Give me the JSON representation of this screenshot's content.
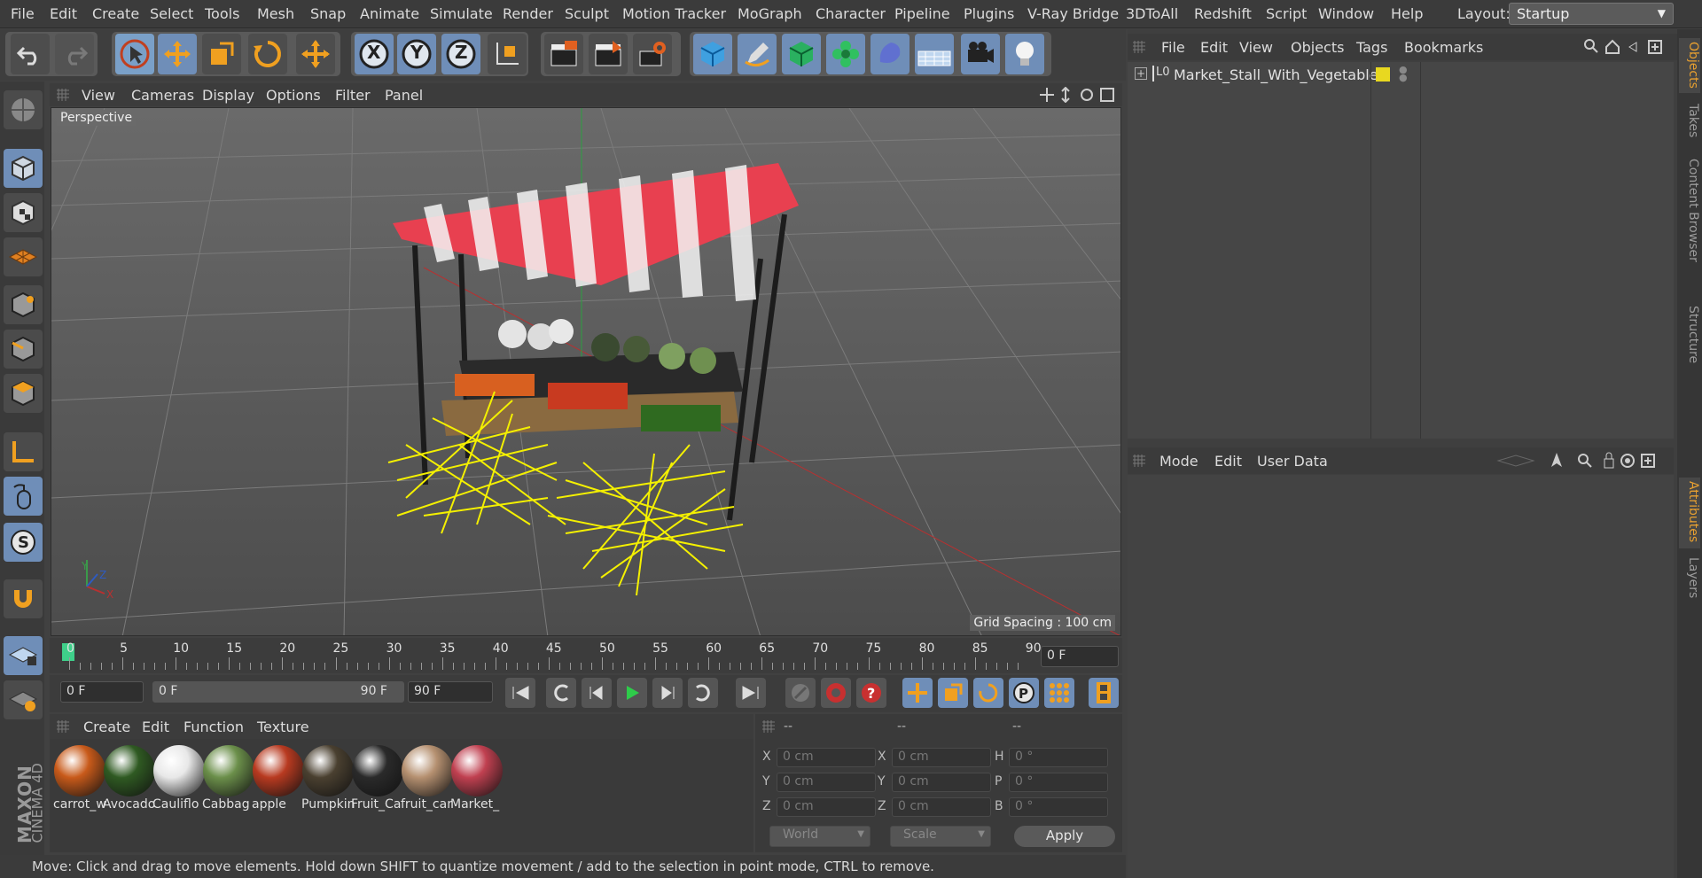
{
  "menu": [
    "File",
    "Edit",
    "Create",
    "Select",
    "Tools",
    "Mesh",
    "Snap",
    "Animate",
    "Simulate",
    "Render",
    "Sculpt",
    "Motion Tracker",
    "MoGraph",
    "Character",
    "Pipeline",
    "Plugins",
    "V-Ray Bridge",
    "3DToAll",
    "Redshift",
    "Script",
    "Window",
    "Help"
  ],
  "layout": {
    "label": "Layout:",
    "value": "Startup"
  },
  "toolbar": {
    "x_label": "X",
    "y_label": "Y",
    "z_label": "Z"
  },
  "viewport": {
    "menu": [
      "View",
      "Cameras",
      "Display",
      "Options",
      "Filter",
      "Panel"
    ],
    "label": "Perspective",
    "grid_spacing": "Grid Spacing : 100 cm",
    "axis": {
      "x": "X",
      "y": "Y",
      "z": "Z"
    }
  },
  "timeline": {
    "ticks": [
      "0",
      "5",
      "10",
      "15",
      "20",
      "25",
      "30",
      "35",
      "40",
      "45",
      "50",
      "55",
      "60",
      "65",
      "70",
      "75",
      "80",
      "85",
      "90"
    ],
    "current_frame": "0 F"
  },
  "playback": {
    "start": "0 F",
    "range_start": "0 F",
    "range_end": "90 F",
    "end": "90 F"
  },
  "materials": {
    "menu": [
      "Create",
      "Edit",
      "Function",
      "Texture"
    ],
    "items": [
      {
        "name": "carrot_w",
        "color": "#c85a1a"
      },
      {
        "name": "Avocado",
        "color": "#2f5a22"
      },
      {
        "name": "Cauliflo",
        "color": "#e8e8e8"
      },
      {
        "name": "Cabbag",
        "color": "#6b8f4a"
      },
      {
        "name": "apple",
        "color": "#b83a20"
      },
      {
        "name": "Pumpkin",
        "color": "#4a4030"
      },
      {
        "name": "Fruit_Ca",
        "color": "#2a2a2a"
      },
      {
        "name": "fruit_car",
        "color": "#b59070"
      },
      {
        "name": "Market_",
        "color": "#c04050"
      }
    ]
  },
  "coords": {
    "headers": [
      "--",
      "--",
      "--"
    ],
    "rows": [
      {
        "l1": "X",
        "v1": "0 cm",
        "l2": "X",
        "v2": "0 cm",
        "l3": "H",
        "v3": "0 °"
      },
      {
        "l1": "Y",
        "v1": "0 cm",
        "l2": "Y",
        "v2": "0 cm",
        "l3": "P",
        "v3": "0 °"
      },
      {
        "l1": "Z",
        "v1": "0 cm",
        "l2": "Z",
        "v2": "0 cm",
        "l3": "B",
        "v3": "0 °"
      }
    ],
    "world": "World",
    "scale": "Scale",
    "apply": "Apply"
  },
  "status": "Move: Click and drag to move elements. Hold down SHIFT to quantize movement / add to the selection in point mode, CTRL to remove.",
  "objects": {
    "menu": [
      "File",
      "Edit",
      "View",
      "Objects",
      "Tags",
      "Bookmarks"
    ],
    "items": [
      {
        "name": "Market_Stall_With_Vegetables",
        "tag_color": "#e8d820"
      }
    ]
  },
  "attributes": {
    "menu": [
      "Mode",
      "Edit",
      "User Data"
    ]
  },
  "side_tabs": [
    "Objects",
    "Takes",
    "Content Browser",
    "Structure",
    "Attributes",
    "Layers"
  ],
  "logo": {
    "brand": "MAXON",
    "product": "CINEMA 4D"
  }
}
